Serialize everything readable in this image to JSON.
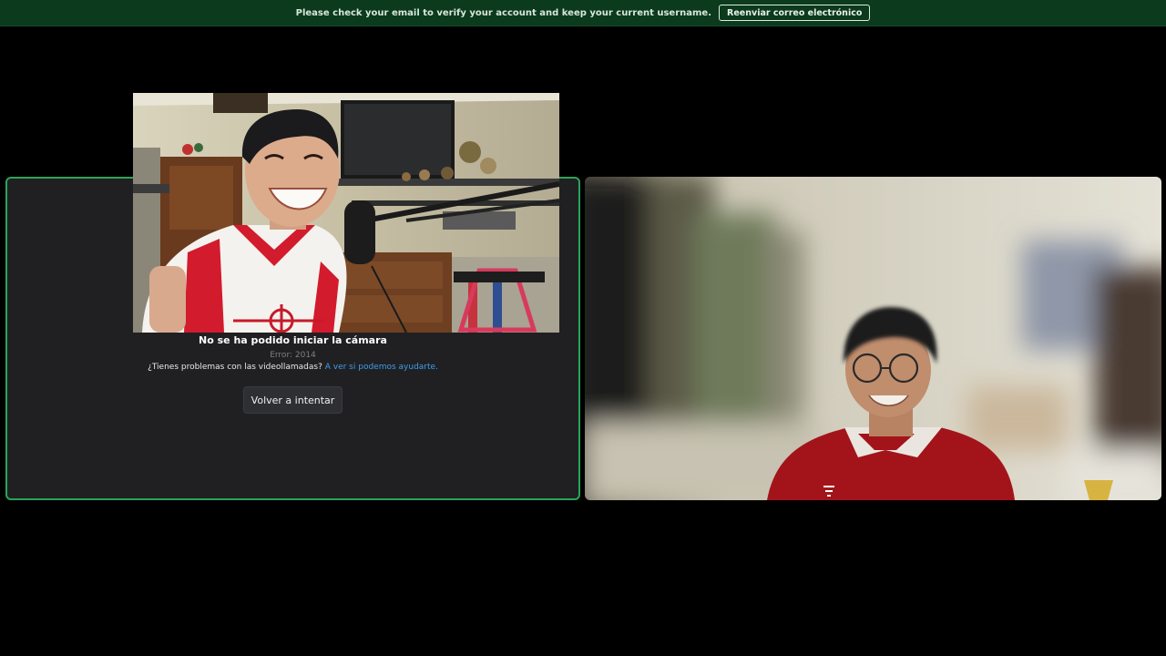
{
  "notice_bar": {
    "message": "Please check your email to verify your account and keep your current username.",
    "resend_button_label": "Reenviar correo electrónico"
  },
  "self_tile": {
    "error_title": "No se ha podido iniciar la cámara",
    "error_code": "Error: 2014",
    "help_question": "¿Tienes problemas con las videollamadas?",
    "help_link_label": "A ver si podemos ayudarte.",
    "retry_button_label": "Volver a intentar"
  },
  "colors": {
    "notice_background": "#0b3a1c",
    "active_border": "#2ba45a",
    "link": "#3f9cf0",
    "tile_background": "#202022"
  }
}
